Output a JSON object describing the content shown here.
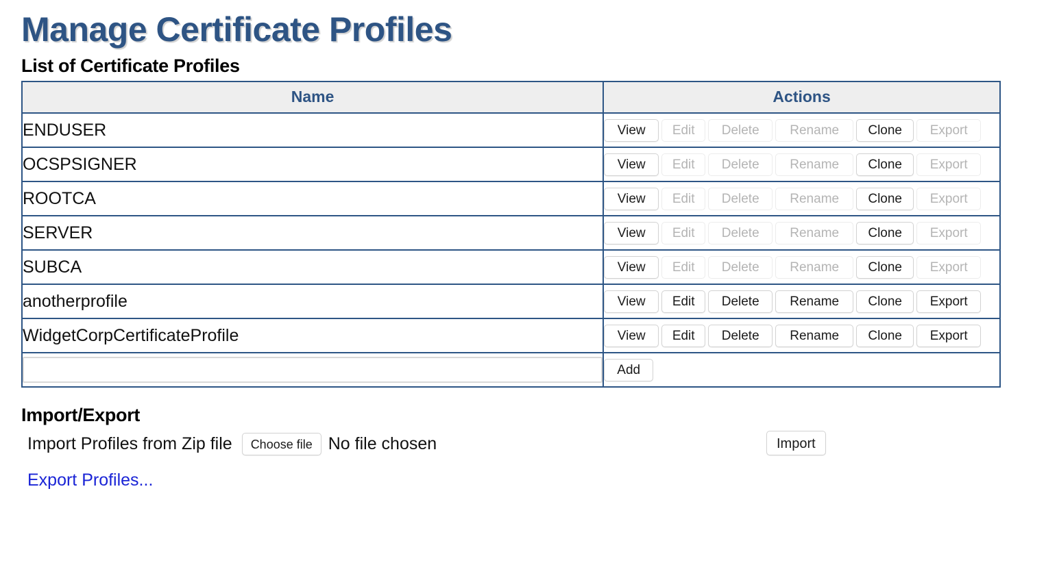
{
  "page": {
    "title": "Manage Certificate Profiles"
  },
  "list_section": {
    "heading": "List of Certificate Profiles",
    "columns": {
      "name": "Name",
      "actions": "Actions"
    },
    "action_labels": {
      "view": "View",
      "edit": "Edit",
      "delete": "Delete",
      "rename": "Rename",
      "clone": "Clone",
      "export": "Export"
    },
    "rows": [
      {
        "name": "ENDUSER",
        "enabled": {
          "view": true,
          "edit": false,
          "delete": false,
          "rename": false,
          "clone": true,
          "export": false
        }
      },
      {
        "name": "OCSPSIGNER",
        "enabled": {
          "view": true,
          "edit": false,
          "delete": false,
          "rename": false,
          "clone": true,
          "export": false
        }
      },
      {
        "name": "ROOTCA",
        "enabled": {
          "view": true,
          "edit": false,
          "delete": false,
          "rename": false,
          "clone": true,
          "export": false
        }
      },
      {
        "name": "SERVER",
        "enabled": {
          "view": true,
          "edit": false,
          "delete": false,
          "rename": false,
          "clone": true,
          "export": false
        }
      },
      {
        "name": "SUBCA",
        "enabled": {
          "view": true,
          "edit": false,
          "delete": false,
          "rename": false,
          "clone": true,
          "export": false
        }
      },
      {
        "name": "anotherprofile",
        "enabled": {
          "view": true,
          "edit": true,
          "delete": true,
          "rename": true,
          "clone": true,
          "export": true
        }
      },
      {
        "name": "WidgetCorpCertificateProfile",
        "enabled": {
          "view": true,
          "edit": true,
          "delete": true,
          "rename": true,
          "clone": true,
          "export": true
        }
      }
    ],
    "add_row": {
      "input_value": "",
      "input_placeholder": "",
      "add_label": "Add"
    }
  },
  "import_export": {
    "heading": "Import/Export",
    "import_label": "Import Profiles from Zip file",
    "choose_file_label": "Choose file",
    "no_file_text": "No file chosen",
    "import_button_label": "Import",
    "export_link_label": "Export Profiles..."
  },
  "colors": {
    "heading_blue": "#2e5484",
    "table_border": "#2d5585",
    "header_bg": "#eeeeee",
    "link_blue": "#1a24d6",
    "disabled_text": "#b4b4b4"
  }
}
